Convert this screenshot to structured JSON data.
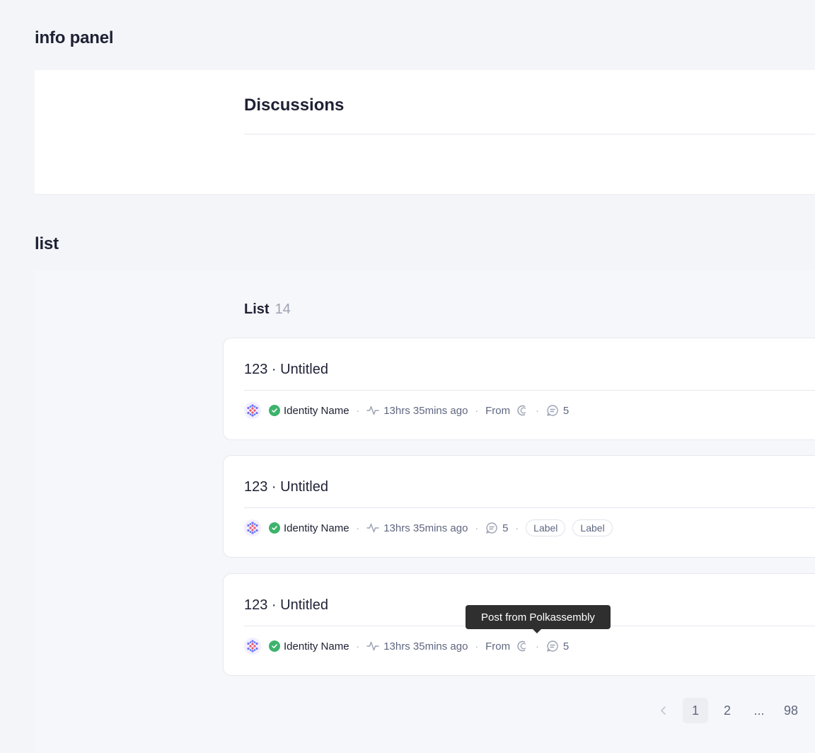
{
  "sections": {
    "info_panel_title": "info panel",
    "list_title": "list"
  },
  "info_panel": {
    "heading": "Discussions"
  },
  "list": {
    "label": "List",
    "count": "14",
    "items": [
      {
        "title": "123 · Untitled",
        "author": "Identity Name",
        "time": "13hrs 35mins ago",
        "from_label": "From",
        "comments": "5"
      },
      {
        "title": "123 · Untitled",
        "author": "Identity Name",
        "time": "13hrs 35mins ago",
        "comments": "5",
        "labels": [
          "Label",
          "Label"
        ]
      },
      {
        "title": "123 · Untitled",
        "author": "Identity Name",
        "time": "13hrs 35mins ago",
        "from_label": "From",
        "comments": "5"
      }
    ]
  },
  "tooltip": {
    "text": "Post from Polkassembly"
  },
  "pagination": {
    "prev_icon": "chevron-left-icon",
    "pages": [
      "1",
      "2",
      "...",
      "98"
    ],
    "active": "1"
  },
  "colors": {
    "background": "#f4f5f8",
    "verified": "#3db36c",
    "text_primary": "#1e2134",
    "text_secondary": "#5f6680",
    "tooltip_bg": "#2f2f2f"
  }
}
